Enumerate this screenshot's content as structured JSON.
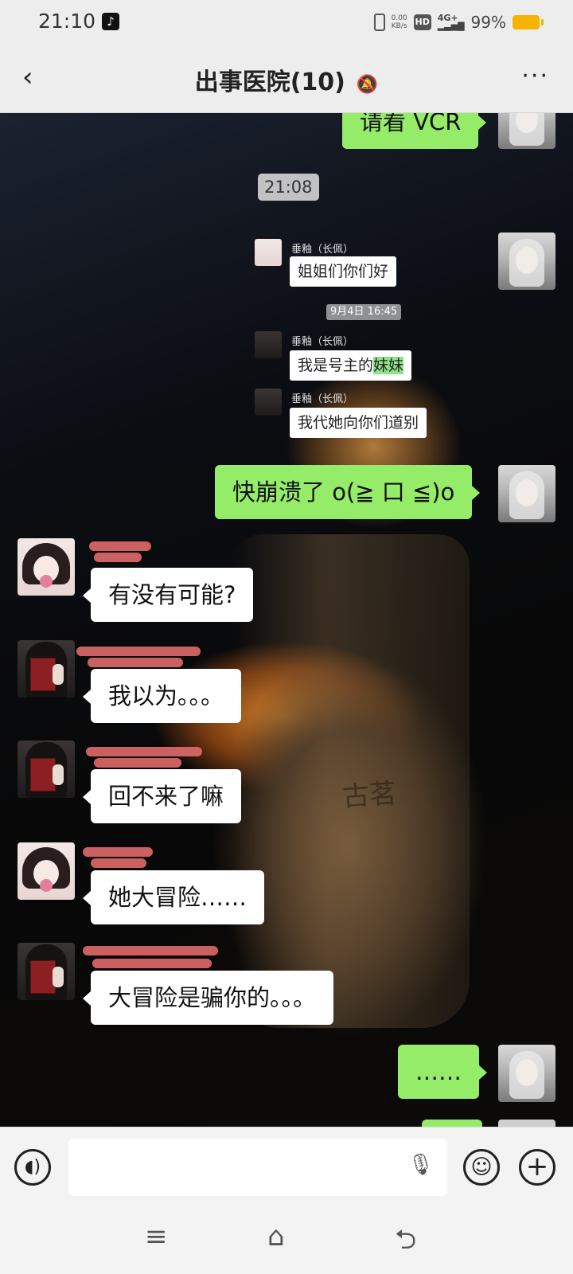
{
  "status_bar": {
    "time": "21:10",
    "app_notification_icon": "tiktok-icon",
    "net_speed": "0.00\nKB/s",
    "hd_label": "HD",
    "signal_label": "4G+",
    "battery": "99%"
  },
  "header": {
    "back_icon": "back-arrow-icon",
    "title": "出事医院(10)",
    "mute_icon": "muted-bell-icon",
    "more_label": "···"
  },
  "background": {
    "cup_brand_text": "古茗"
  },
  "messages": {
    "top_out": "请看 VCR",
    "timestamp": "21:08",
    "forwarded": {
      "sender_1": "垂釉（长佩）",
      "msg_1": "姐姐们你们好",
      "time_chip": "9月4日 16:45",
      "sender_2": "垂釉（长佩）",
      "msg_2a": "我是号主的",
      "msg_2b": "妹妹",
      "sender_3": "垂釉（长佩）",
      "msg_3": "我代她向你们道别"
    },
    "out_2": "快崩溃了 o(≧ 口 ≦)o",
    "in_1": "有没有可能?",
    "in_2": "我以为。。。",
    "in_3": "回不来了嘛",
    "in_4": "她大冒险……",
    "in_5": "大冒险是骗你的。。。",
    "out_3": "……"
  },
  "input_bar": {
    "placeholder": "",
    "voice_icon": "voice-icon",
    "mic_icon": "microphone-icon",
    "emoji_icon": "emoji-icon",
    "plus_icon": "plus-icon"
  },
  "nav_bar": {
    "menu_icon": "menu-icon",
    "home_icon": "home-icon",
    "back_icon": "back-icon"
  }
}
